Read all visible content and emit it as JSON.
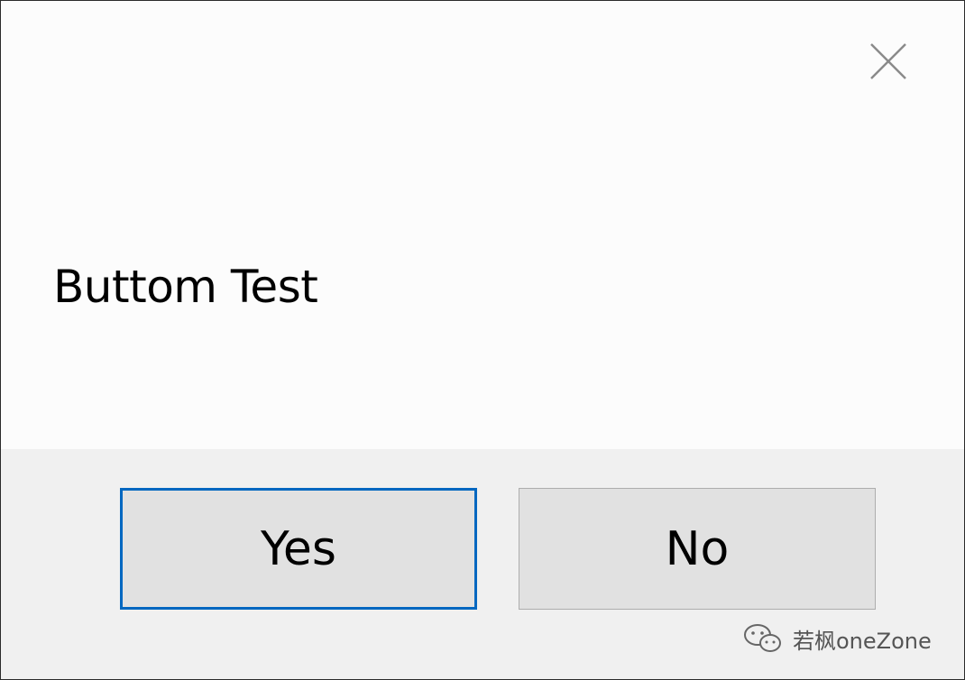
{
  "dialog": {
    "message": "Buttom Test",
    "close_icon": "close-icon"
  },
  "buttons": {
    "yes_label": "Yes",
    "no_label": "No"
  },
  "watermark": {
    "icon": "wechat-icon",
    "text": "若枫oneZone"
  },
  "colors": {
    "content_background": "#fcfcfc",
    "button_bar_background": "#f0f0f0",
    "button_face": "#e1e1e1",
    "focus_border": "#0067c0",
    "button_border": "#adadad"
  }
}
